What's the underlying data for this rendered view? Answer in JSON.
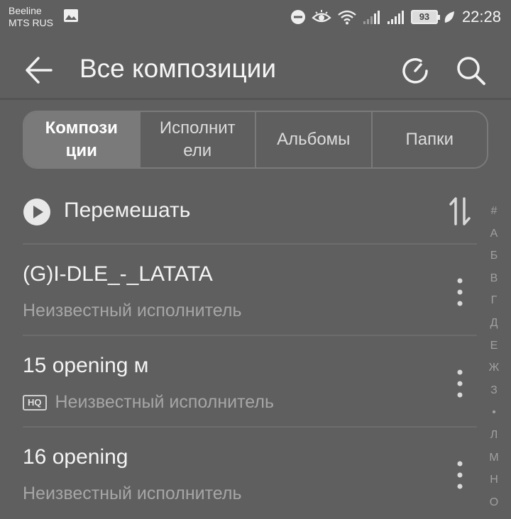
{
  "status_bar": {
    "carrier_1": "Beeline",
    "carrier_2": "MTS RUS",
    "battery_level": "93",
    "time": "22:28",
    "icons": [
      "image-icon",
      "do-not-disturb-icon",
      "eye-comfort-icon",
      "wifi-icon",
      "signal-icon",
      "signal-icon",
      "battery-icon",
      "leaf-icon"
    ]
  },
  "app_bar": {
    "title": "Все композиции"
  },
  "tabs": [
    {
      "label": "Компози\nции",
      "selected": true
    },
    {
      "label": "Исполнит\nели",
      "selected": false
    },
    {
      "label": "Альбомы",
      "selected": false
    },
    {
      "label": "Папки",
      "selected": false
    }
  ],
  "shuffle": {
    "label": "Перемешать"
  },
  "songs": [
    {
      "title": "(G)I-DLE_-_LATATA",
      "artist": "Неизвестный исполнитель",
      "badge": ""
    },
    {
      "title": "15 opening м",
      "artist": "Неизвестный исполнитель",
      "badge": "HQ"
    },
    {
      "title": "16 opening",
      "artist": "Неизвестный исполнитель",
      "badge": ""
    }
  ],
  "alphabet_index": [
    "#",
    "А",
    "Б",
    "В",
    "Г",
    "Д",
    "Е",
    "Ж",
    "З",
    "•",
    "Л",
    "М",
    "Н",
    "О"
  ]
}
